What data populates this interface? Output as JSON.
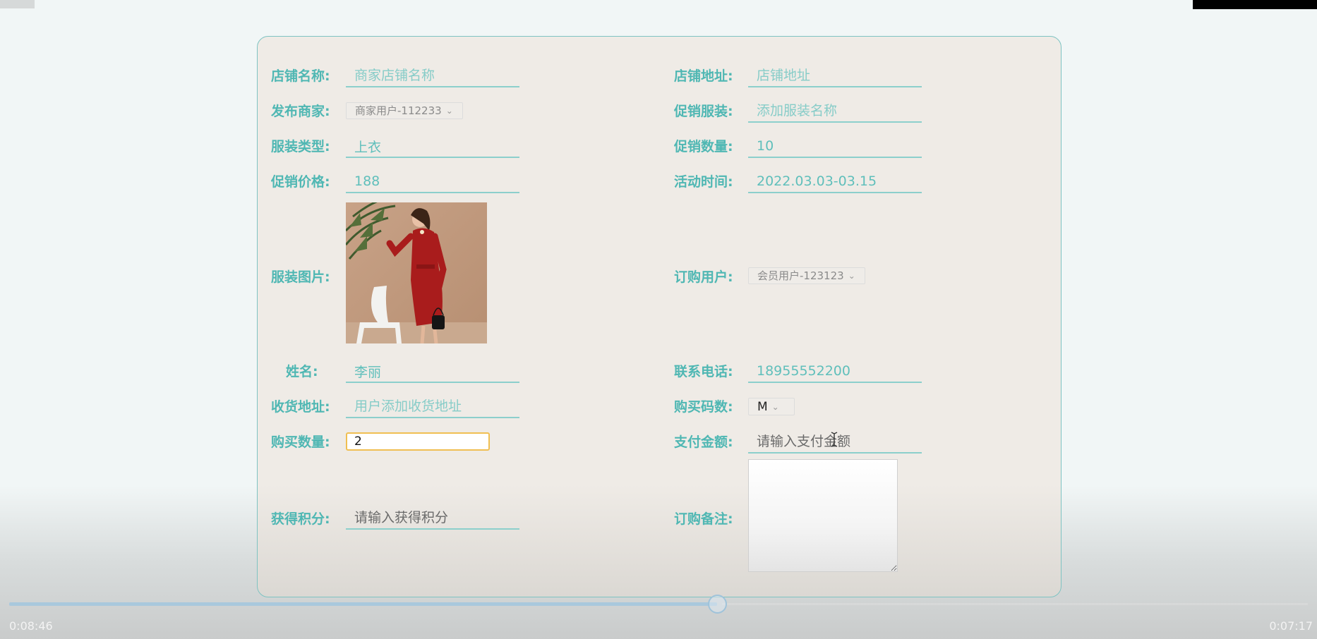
{
  "form": {
    "shop_name": {
      "label": "店铺名称:",
      "placeholder": "商家店铺名称"
    },
    "shop_address": {
      "label": "店铺地址:",
      "placeholder": "店铺地址"
    },
    "merchant": {
      "label": "发布商家:",
      "value": "商家用户-112233"
    },
    "promo_clothing": {
      "label": "促销服装:",
      "placeholder": "添加服装名称"
    },
    "clothing_type": {
      "label": "服装类型:",
      "value": "上衣"
    },
    "promo_quantity": {
      "label": "促销数量:",
      "value": "10"
    },
    "promo_price": {
      "label": "促销价格:",
      "value": "188"
    },
    "event_time": {
      "label": "活动时间:",
      "value": "2022.03.03-03.15"
    },
    "clothing_image": {
      "label": "服装图片:"
    },
    "order_user": {
      "label": "订购用户:",
      "value": "会员用户-123123"
    },
    "name": {
      "label": "姓名:",
      "value": "李丽"
    },
    "phone": {
      "label": "联系电话:",
      "value": "18955552200"
    },
    "shipping_address": {
      "label": "收货地址:",
      "placeholder": "用户添加收货地址"
    },
    "size": {
      "label": "购买码数:",
      "value": "M"
    },
    "buy_quantity": {
      "label": "购买数量:",
      "value": "2"
    },
    "payment_amount": {
      "label": "支付金额:",
      "placeholder": "请输入支付金额"
    },
    "points": {
      "label": "获得积分:",
      "placeholder": "请输入获得积分"
    },
    "remark": {
      "label": "订购备注:",
      "value": ""
    }
  },
  "player": {
    "elapsed": "0:08:46",
    "remaining": "0:07:17",
    "progress": 0.545
  },
  "colors": {
    "accent": "#4fb7b3",
    "panel_border": "#7ec3c2",
    "focus_border": "#f0bf52"
  }
}
